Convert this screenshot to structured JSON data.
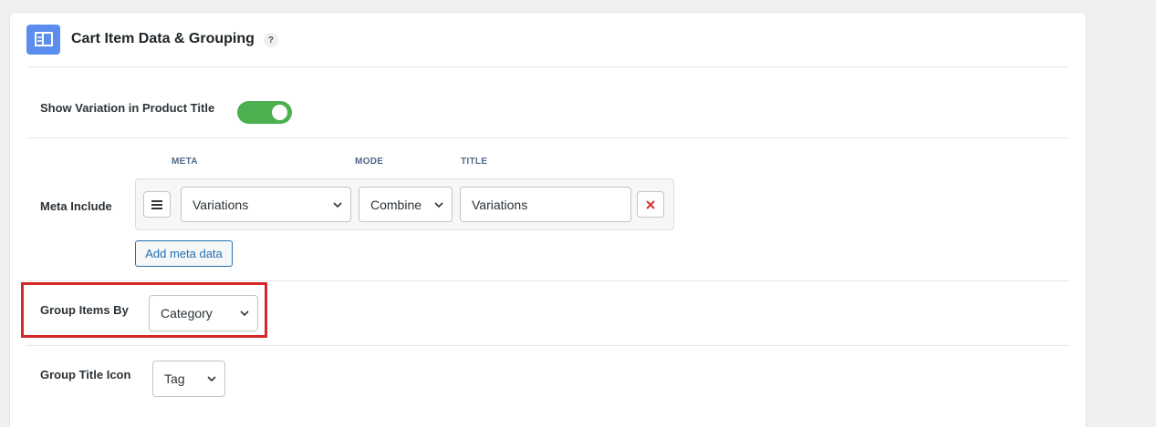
{
  "panel": {
    "title": "Cart Item Data & Grouping",
    "help_symbol": "?",
    "header_icon": "layout-icon",
    "accent_color": "#5b8def"
  },
  "show_variation": {
    "label": "Show Variation in Product Title",
    "enabled": true,
    "toggle_color": "#4caf50"
  },
  "meta_include": {
    "label": "Meta Include",
    "columns": {
      "meta": "META",
      "mode": "MODE",
      "title": "TITLE"
    },
    "rows": [
      {
        "meta": "Variations",
        "mode": "Combine",
        "title": "Variations"
      }
    ],
    "add_label": "Add meta data"
  },
  "group_items_by": {
    "label": "Group Items By",
    "value": "Category",
    "highlight_color": "#d62828"
  },
  "group_title_icon": {
    "label": "Group Title Icon",
    "value": "Tag"
  }
}
